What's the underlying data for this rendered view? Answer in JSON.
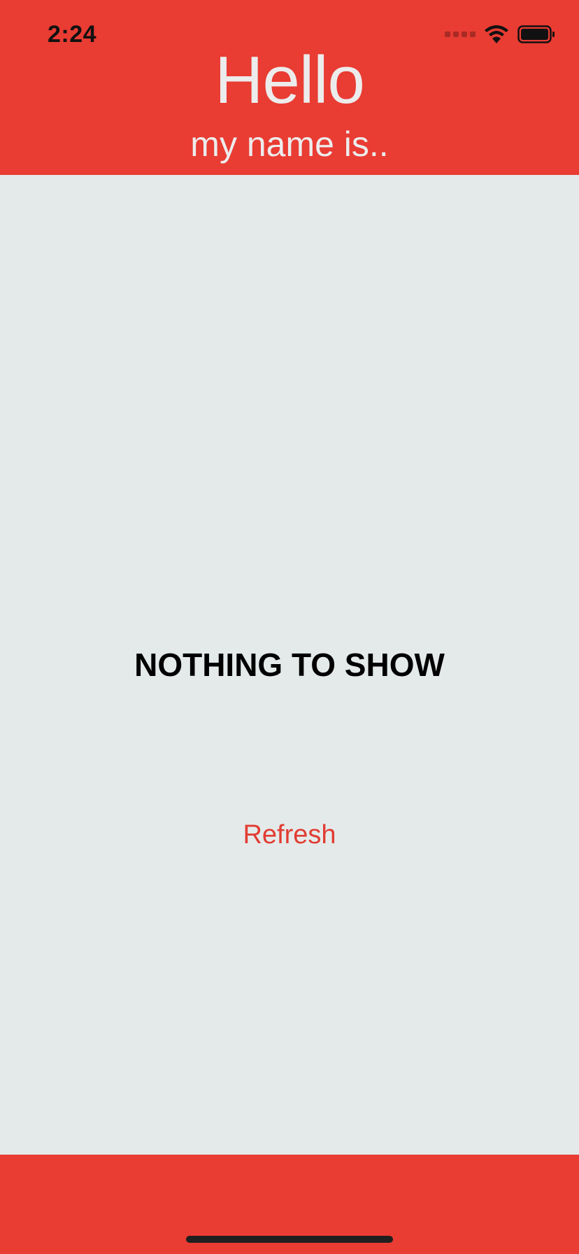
{
  "status_bar": {
    "time": "2:24",
    "icons": [
      "cellular-signal-icon",
      "wifi-icon",
      "battery-icon"
    ]
  },
  "header": {
    "title": "Hello",
    "subtitle": "my name is.."
  },
  "main": {
    "empty_message": "NOTHING TO SHOW",
    "refresh_label": "Refresh"
  },
  "colors": {
    "brand_red": "#e93c33",
    "background": "#e4eaea",
    "header_text": "#ececec",
    "action_text": "#e23c32"
  }
}
